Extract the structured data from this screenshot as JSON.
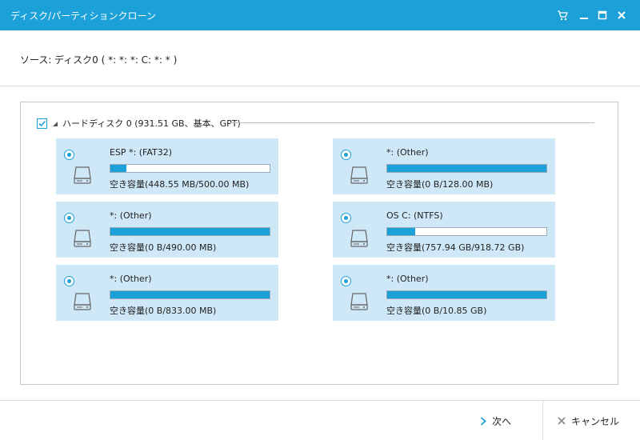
{
  "window": {
    "title": "ディスク/パーティションクローン",
    "icons": [
      "cart-icon",
      "minimize-icon",
      "maximize-icon",
      "close-icon"
    ]
  },
  "source": {
    "label": "ソース:",
    "value": "ディスク0 ( *: *: *: C: *: * )"
  },
  "disk": {
    "label": "ハードディスク 0 (931.51 GB、基本、GPT)",
    "checked": true
  },
  "partitions": [
    {
      "name": "ESP *: (FAT32)",
      "free": "空き容量(448.55 MB/500.00 MB)",
      "used_fraction": 0.1
    },
    {
      "name": "*: (Other)",
      "free": "空き容量(0 B/128.00 MB)",
      "used_fraction": 1.0
    },
    {
      "name": "*: (Other)",
      "free": "空き容量(0 B/490.00 MB)",
      "used_fraction": 1.0
    },
    {
      "name": "OS C: (NTFS)",
      "free": "空き容量(757.94 GB/918.72 GB)",
      "used_fraction": 0.175
    },
    {
      "name": "*: (Other)",
      "free": "空き容量(0 B/833.00 MB)",
      "used_fraction": 1.0
    },
    {
      "name": "*: (Other)",
      "free": "空き容量(0 B/10.85 GB)",
      "used_fraction": 1.0
    }
  ],
  "footer": {
    "next_label": "次へ",
    "cancel_label": "キャンセル"
  },
  "colors": {
    "accent": "#1ba0d7",
    "partition_bg": "#cfe8f7"
  }
}
